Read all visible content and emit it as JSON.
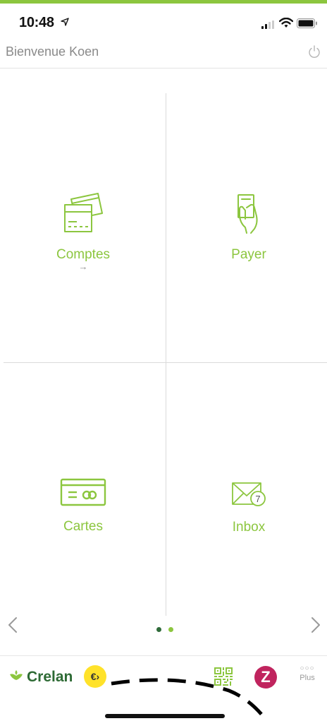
{
  "status": {
    "time": "10:48",
    "icons": [
      "location-arrow-icon",
      "signal-icon",
      "wifi-icon",
      "battery-icon"
    ]
  },
  "header": {
    "welcome": "Bienvenue Koen",
    "power_icon": "power-icon"
  },
  "tiles": [
    {
      "label": "Comptes",
      "sub": "→",
      "icon": "cards-icon"
    },
    {
      "label": "Payer",
      "icon": "hand-card-icon"
    },
    {
      "label": "Cartes",
      "icon": "credit-card-icon"
    },
    {
      "label": "Inbox",
      "icon": "envelope-icon",
      "badge": "7"
    }
  ],
  "pager": {
    "prev_icon": "chevron-left-icon",
    "next_icon": "chevron-right-icon",
    "pages": 2,
    "active": 1
  },
  "bottombar": {
    "brand": "Crelan",
    "euro_label": "€›",
    "z_label": "Z",
    "plus_label": "Plus"
  },
  "colors": {
    "accent": "#8cc63f",
    "brand_dark": "#2d6a34",
    "euro": "#ffe22a",
    "z": "#c0245e"
  }
}
